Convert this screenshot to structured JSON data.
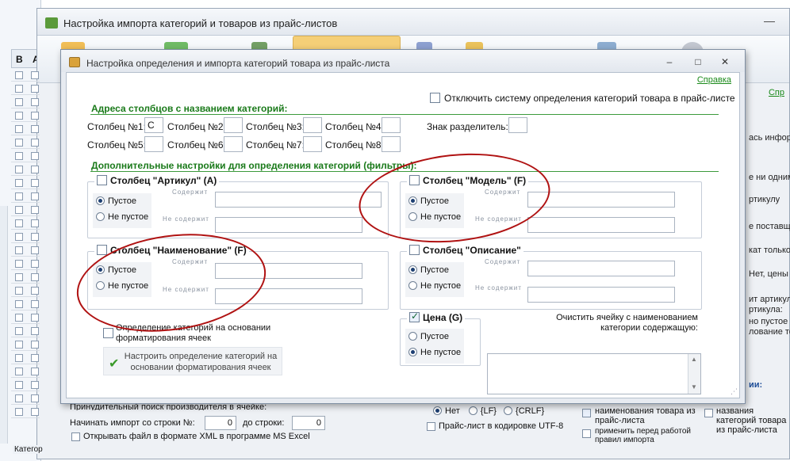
{
  "background": {
    "grid_headers": [
      "В",
      "А"
    ],
    "window_title": "Настройка импорта категорий и товаров из прайс-листов",
    "right_help_link": "Спр",
    "right_fragments": [
      "ась информ",
      "е ни одним",
      "ртикулу",
      "е поставщ",
      "кат только",
      "Нет, цены д",
      "ит артикул",
      "ртикула:",
      "но пустое в",
      "лование тов",
      "ии:"
    ],
    "bottom": {
      "line1": "Принудительный поиск производителя в ячейке:",
      "start_label": "Начинать импорт со строки №:",
      "start_value": "0",
      "to_label": "до строки:",
      "to_value": "0",
      "xml_label": "Открывать файл в формате XML в программе MS Excel",
      "radio_net": "Нет",
      "radio_lf": "{LF}",
      "radio_crlf": "{CRLF}",
      "utf8_label": "Прайс-лист в кодировке UTF-8",
      "name_check_1": "наименования товара из прайс-листа",
      "name_check_2": "применить перед работой правил импорта",
      "name_check_3": "названия категорий товара из прайс-листа"
    },
    "left_strip_text": "Категор"
  },
  "dialog": {
    "title": "Настройка определения и импорта категорий товара из прайс-листа",
    "help_link": "Справка",
    "disable_label": "Отключить систему определения категорий товара в прайс-листе",
    "disable_checked": false,
    "addresses": {
      "title": "Адреса столбцов с названием категорий:",
      "columns": [
        {
          "label": "Столбец №1:",
          "value": "C"
        },
        {
          "label": "Столбец №2:",
          "value": ""
        },
        {
          "label": "Столбец №3:",
          "value": ""
        },
        {
          "label": "Столбец №4:",
          "value": ""
        },
        {
          "label": "Столбец №5:",
          "value": ""
        },
        {
          "label": "Столбец №6:",
          "value": ""
        },
        {
          "label": "Столбец №7:",
          "value": ""
        },
        {
          "label": "Столбец №8:",
          "value": ""
        }
      ],
      "separator_label": "Знак разделитель:",
      "separator_value": ""
    },
    "filters": {
      "title": "Дополнительные настройки для определения категорий (фильтры):",
      "contains": "Содержит",
      "not_contains": "Не содержит",
      "empty": "Пустое",
      "not_empty": "Не пустое",
      "groups": [
        {
          "title": "Столбец \"Артикул\" (A)",
          "checked": false,
          "selected": "empty"
        },
        {
          "title": "Столбец \"Модель\" (F)",
          "checked": false,
          "selected": "empty"
        },
        {
          "title": "Столбец \"Наименование\" (F)",
          "checked": false,
          "selected": "empty"
        },
        {
          "title": "Столбец \"Описание\"",
          "checked": false,
          "selected": "empty"
        },
        {
          "title": "Цена (G)",
          "checked": true,
          "selected": "not_empty"
        }
      ]
    },
    "format_label": "Определение категорий на основании форматирования ячеек",
    "format_checked": false,
    "configure_button": "Настроить определение категорий на основании форматирования ячеек",
    "clear_label": "Очистить ячейку с наименованием категории содержащую:",
    "clear_value": ""
  }
}
